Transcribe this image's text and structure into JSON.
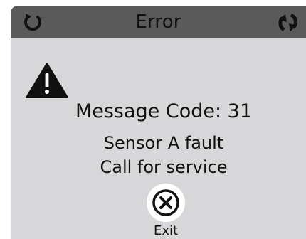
{
  "dialog": {
    "title": "Error",
    "left_icon": "reset-icon",
    "right_icon": "sync-icon"
  },
  "message": {
    "icon": "warning-icon",
    "code_text": "Message Code: 31",
    "line1": "Sensor A fault",
    "line2": "Call for service"
  },
  "exit": {
    "icon": "close-circle-icon",
    "label": "Exit"
  },
  "colors": {
    "titlebar": "#5a5a5a",
    "body": "#d7d7d9",
    "text": "#111111"
  }
}
